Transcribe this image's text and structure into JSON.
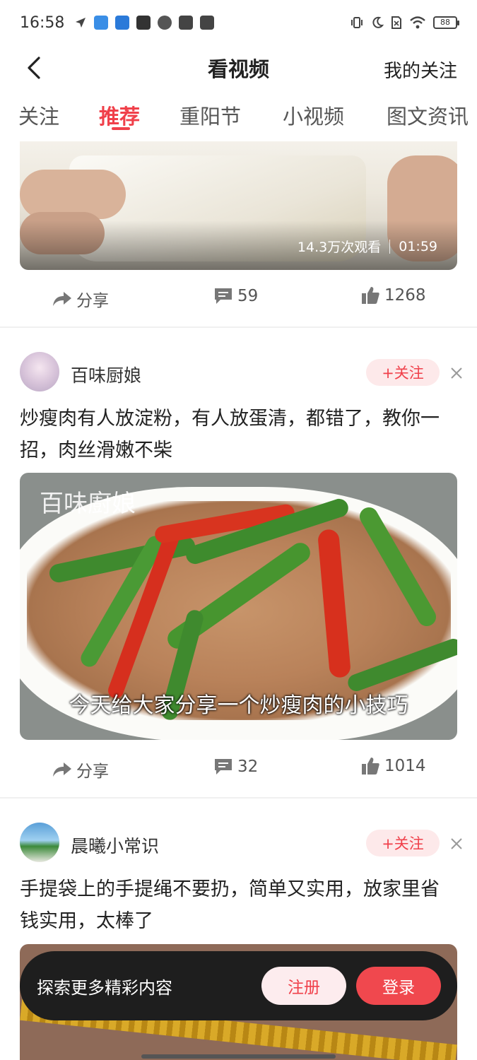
{
  "status_bar": {
    "time": "16:58",
    "battery": "88"
  },
  "header": {
    "title": "看视频",
    "right_link": "我的关注"
  },
  "tabs": [
    {
      "label": "关注"
    },
    {
      "label": "推荐"
    },
    {
      "label": "重阳节"
    },
    {
      "label": "小视频"
    },
    {
      "label": "图文资讯"
    }
  ],
  "active_tab": "推荐",
  "feed": [
    {
      "views": "14.3万次观看",
      "duration": "01:59",
      "share_label": "分享",
      "comments": "59",
      "likes": "1268"
    },
    {
      "author": "百味厨娘",
      "follow_label": "+关注",
      "title": "炒瘦肉有人放淀粉，有人放蛋清，都错了，教你一招，肉丝滑嫩不柴",
      "watermark": "百味廚娘",
      "subtitle": "今天给大家分享一个炒瘦肉的小技巧",
      "share_label": "分享",
      "comments": "32",
      "likes": "1014"
    },
    {
      "author": "晨曦小常识",
      "follow_label": "+关注",
      "title": "手提袋上的手提绳不要扔，简单又实用，放家里省钱实用，太棒了"
    }
  ],
  "login_banner": {
    "text": "探索更多精彩内容",
    "register_label": "注册",
    "login_label": "登录"
  },
  "colors": {
    "accent": "#f0404a",
    "follow_bg": "#fde9ea",
    "banner_bg": "#1e1e1e"
  }
}
